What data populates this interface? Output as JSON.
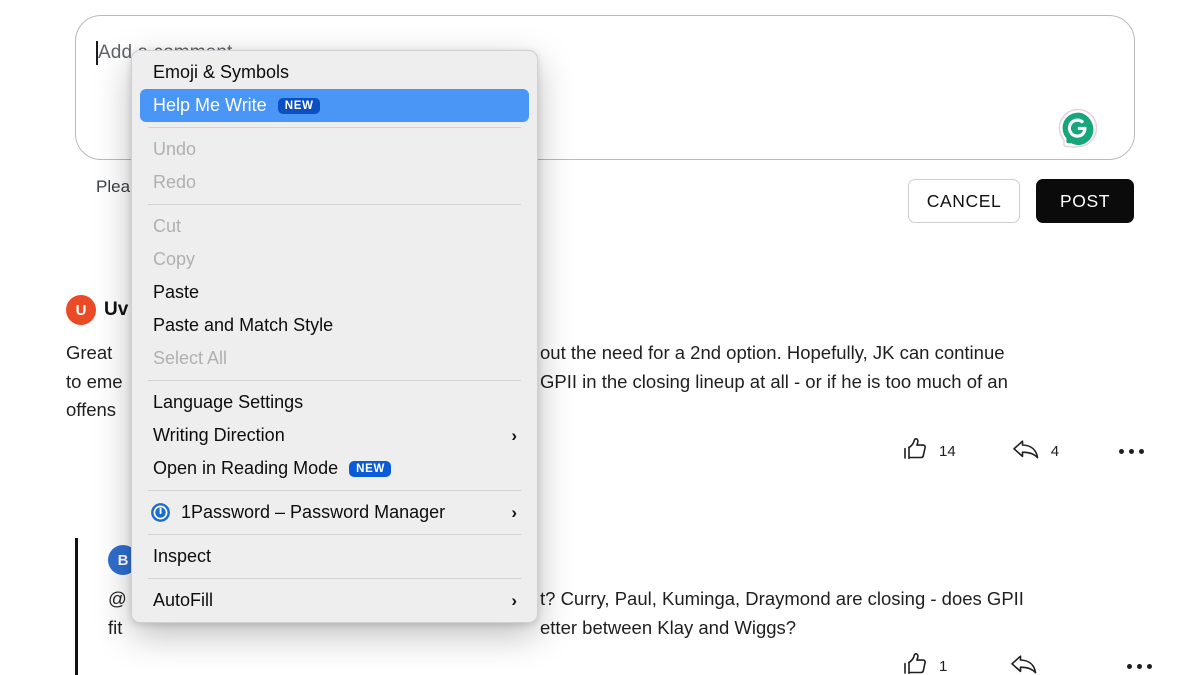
{
  "composer": {
    "placeholder": "Add a comment...",
    "value": "",
    "grammarly_icon": "grammarly-g-icon",
    "accent_green": "#15a67a"
  },
  "disclaimer": {
    "text": "Plea"
  },
  "buttons": {
    "cancel_label": "CANCEL",
    "post_label": "POST",
    "post_bg": "#0b0b0b"
  },
  "context_menu": {
    "items": [
      {
        "label": "Emoji & Symbols",
        "state": "enabled",
        "badge": "",
        "submenu": false,
        "icon": ""
      },
      {
        "label": "Help Me Write",
        "state": "selected",
        "badge": "NEW",
        "submenu": false,
        "icon": ""
      },
      {
        "label": "Undo",
        "state": "disabled",
        "badge": "",
        "submenu": false,
        "icon": ""
      },
      {
        "label": "Redo",
        "state": "disabled",
        "badge": "",
        "submenu": false,
        "icon": ""
      },
      {
        "label": "Cut",
        "state": "disabled",
        "badge": "",
        "submenu": false,
        "icon": ""
      },
      {
        "label": "Copy",
        "state": "disabled",
        "badge": "",
        "submenu": false,
        "icon": ""
      },
      {
        "label": "Paste",
        "state": "enabled",
        "badge": "",
        "submenu": false,
        "icon": ""
      },
      {
        "label": "Paste and Match Style",
        "state": "enabled",
        "badge": "",
        "submenu": false,
        "icon": ""
      },
      {
        "label": "Select All",
        "state": "disabled",
        "badge": "",
        "submenu": false,
        "icon": ""
      },
      {
        "label": "Language Settings",
        "state": "enabled",
        "badge": "",
        "submenu": false,
        "icon": ""
      },
      {
        "label": "Writing Direction",
        "state": "enabled",
        "badge": "",
        "submenu": true,
        "icon": ""
      },
      {
        "label": "Open in Reading Mode",
        "state": "enabled",
        "badge": "NEW",
        "submenu": false,
        "icon": ""
      },
      {
        "label": "1Password – Password Manager",
        "state": "enabled",
        "badge": "",
        "submenu": true,
        "icon": "1password-icon"
      },
      {
        "label": "Inspect",
        "state": "enabled",
        "badge": "",
        "submenu": false,
        "icon": ""
      },
      {
        "label": "AutoFill",
        "state": "enabled",
        "badge": "",
        "submenu": true,
        "icon": ""
      }
    ],
    "highlight_color": "#4a96f7",
    "badge_color": "#0c5bd6",
    "submenu_chevron": "›"
  },
  "comments": [
    {
      "avatar_letter": "U",
      "avatar_color": "#ea4b26",
      "author": "Uv",
      "body_left": "Great \nto eme\noffens",
      "body_right": "out the need for a 2nd option. Hopefully, JK can continue\nGPII in the closing lineup at all - or if he is too much of an",
      "like_count": "14",
      "reply_count": "4",
      "more_label": "•••"
    },
    {
      "avatar_letter": "B",
      "avatar_color": "#2f6fd0",
      "author": "",
      "body_left": "@\nfit",
      "body_right": "t? Curry, Paul, Kuminga, Draymond are closing - does GPII\netter between Klay and Wiggs?",
      "like_count": "1",
      "reply_count": "",
      "more_label": "•••"
    }
  ],
  "icons": {
    "thumbs_up": "thumbs-up-icon",
    "reply": "reply-arrow-icon",
    "more": "more-horizontal-icon"
  }
}
